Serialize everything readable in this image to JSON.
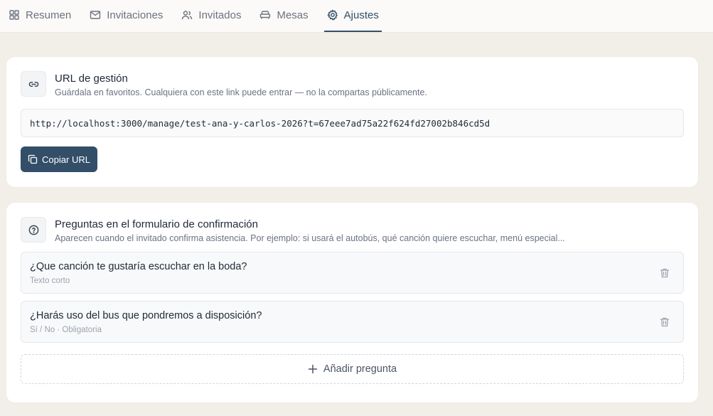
{
  "tabs": [
    {
      "label": "Resumen",
      "icon": "grid-icon"
    },
    {
      "label": "Invitaciones",
      "icon": "mail-icon"
    },
    {
      "label": "Invitados",
      "icon": "users-icon"
    },
    {
      "label": "Mesas",
      "icon": "sofa-icon"
    },
    {
      "label": "Ajustes",
      "icon": "gear-icon",
      "active": true
    }
  ],
  "url_section": {
    "title": "URL de gestión",
    "subtitle": "Guárdala en favoritos. Cualquiera con este link puede entrar — no la compartas públicamente.",
    "url": "http://localhost:3000/manage/test-ana-y-carlos-2026?t=67eee7ad75a22f624fd27002b846cd5d",
    "copy_label": "Copiar URL"
  },
  "questions_section": {
    "title": "Preguntas en el formulario de confirmación",
    "subtitle": "Aparecen cuando el invitado confirma asistencia. Por ejemplo: si usará el autobús, qué canción quiere escuchar, menú especial...",
    "questions": [
      {
        "title": "¿Que canción te gustaría escuchar en la boda?",
        "meta": "Texto corto"
      },
      {
        "title": "¿Harás uso del bus que pondremos a disposición?",
        "meta": "Sí / No · Obligatoria"
      }
    ],
    "add_label": "Añadir pregunta"
  },
  "colors": {
    "accent": "#334e68",
    "background": "#f2efe9"
  }
}
